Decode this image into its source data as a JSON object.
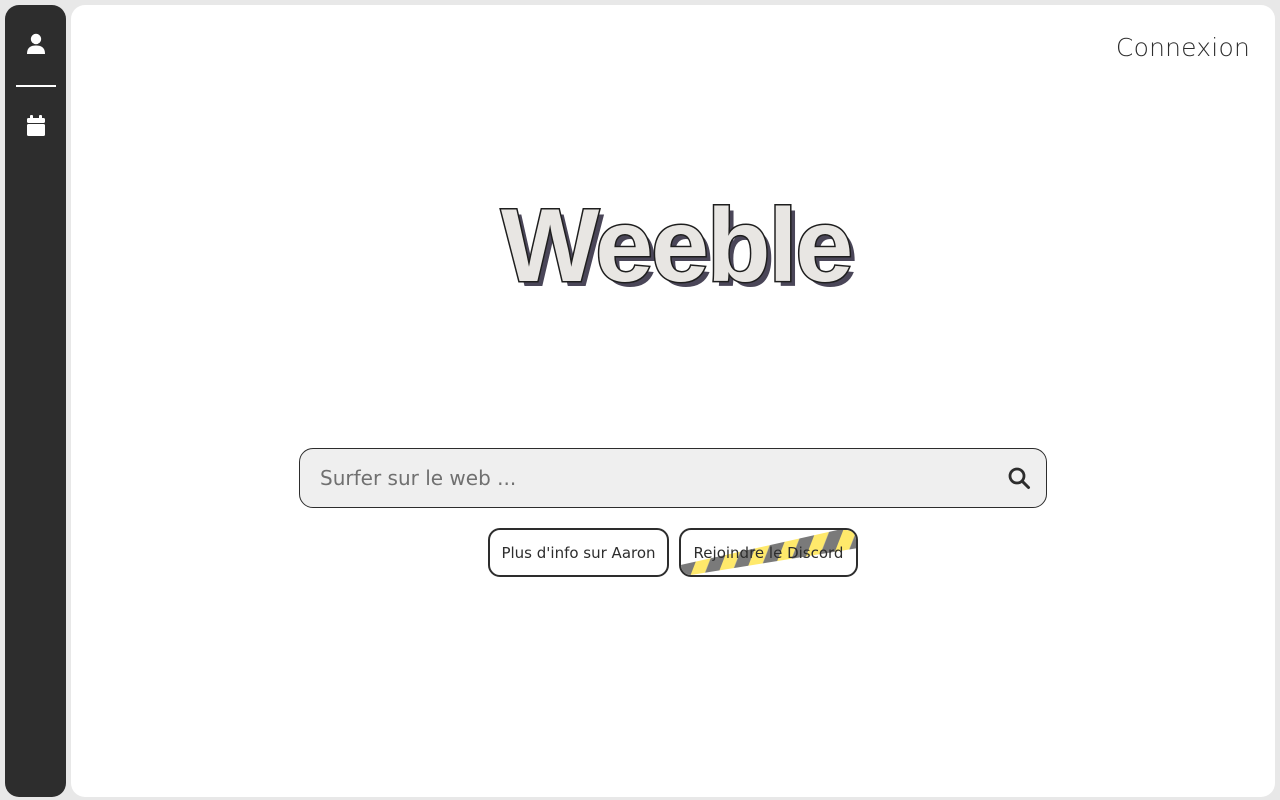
{
  "sidebar": {
    "items": [
      {
        "icon": "user-icon"
      },
      {
        "icon": "calendar-icon"
      }
    ]
  },
  "header": {
    "login_label": "Connexion"
  },
  "logo": {
    "text": "Weeble"
  },
  "search": {
    "placeholder": "Surfer sur le web ...",
    "value": ""
  },
  "actions": {
    "info_label": "Plus d'info sur Aaron",
    "discord_label": "Rejoindre le Discord"
  },
  "colors": {
    "dark": "#2d2d2d",
    "logo_fill": "#e8e6e3",
    "logo_shadow": "#4a4658",
    "stripe_yellow": "#ffe96b",
    "stripe_gray": "#7a7a7a"
  }
}
